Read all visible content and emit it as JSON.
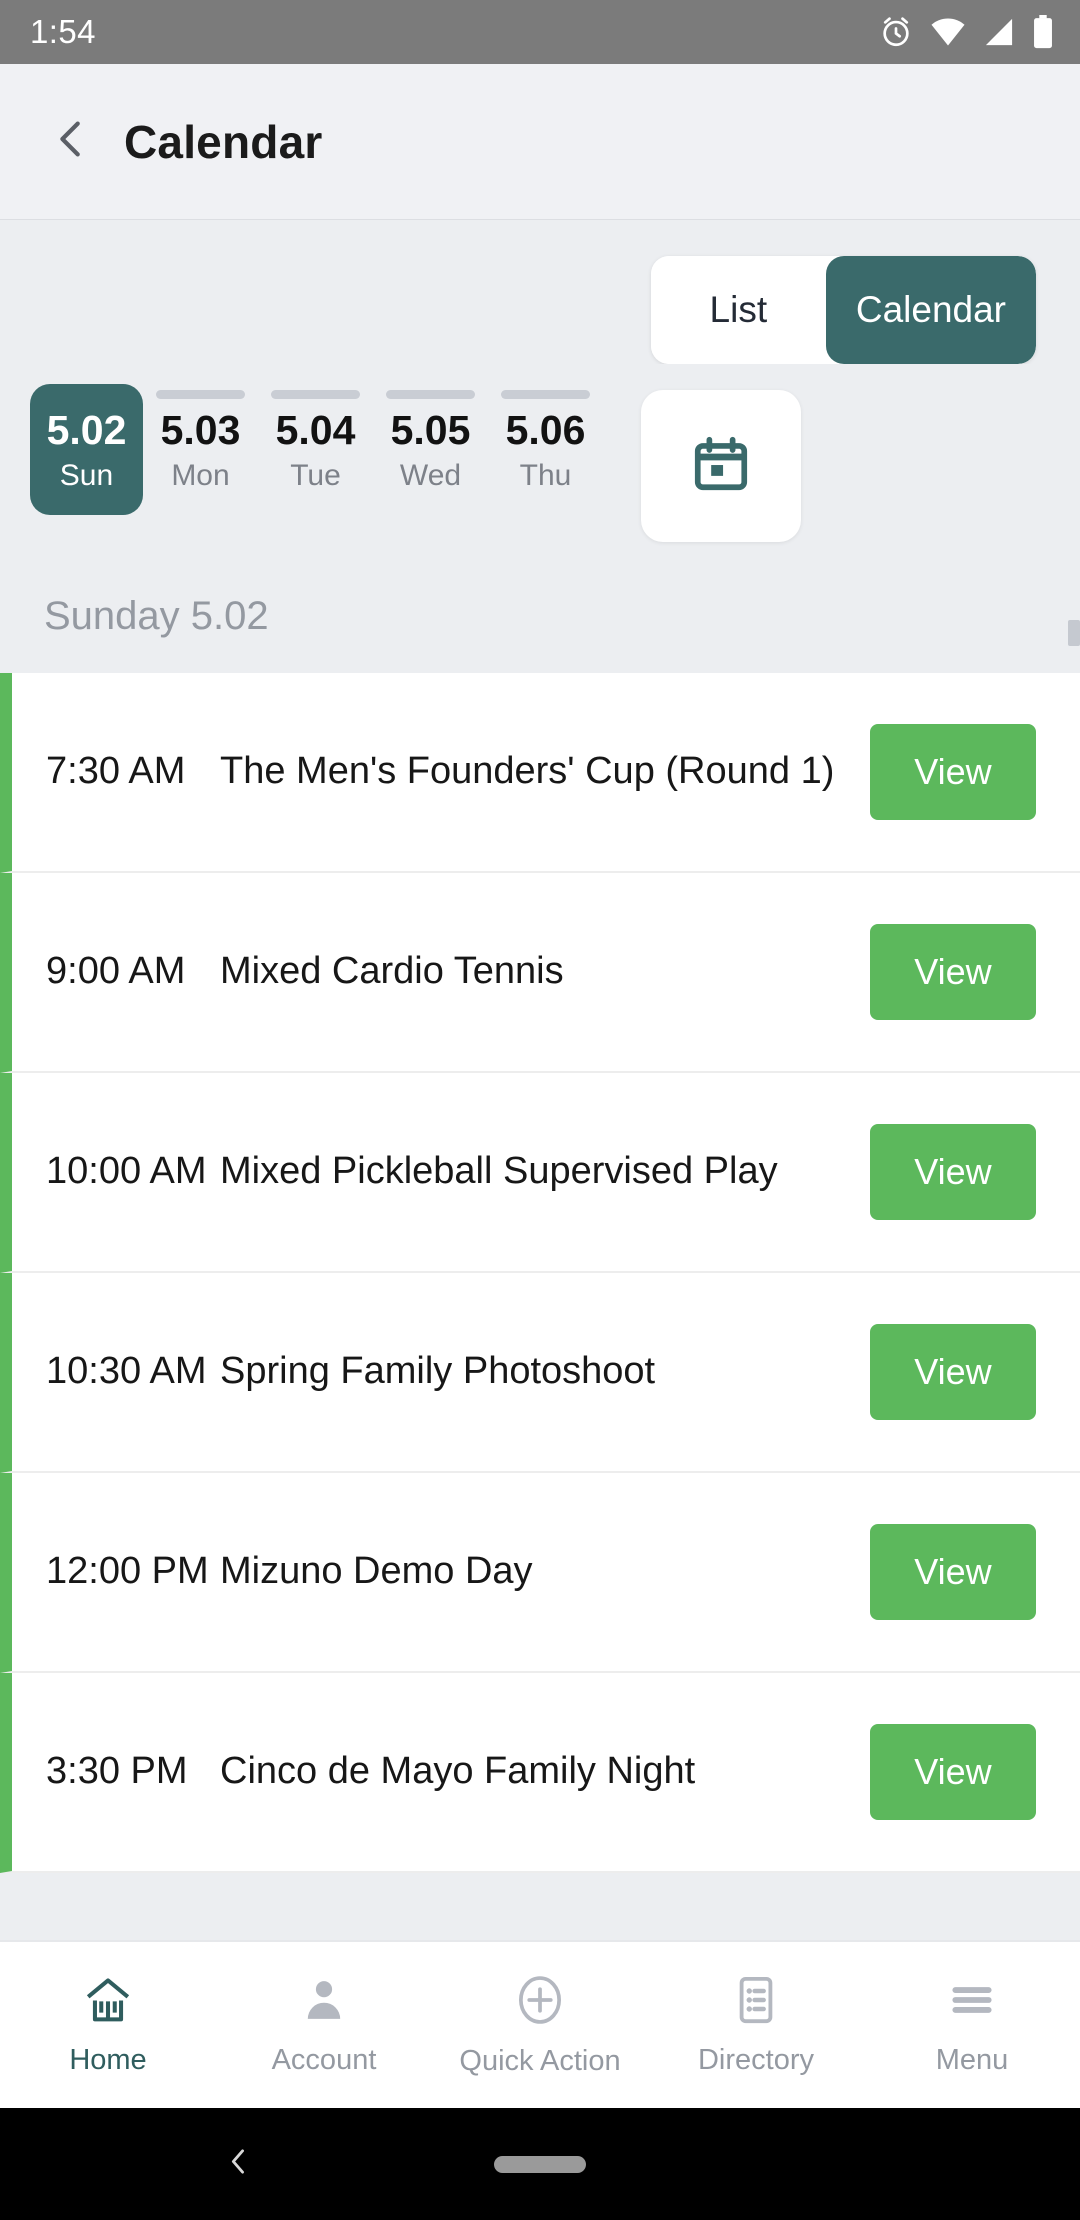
{
  "status_bar": {
    "time": "1:54",
    "icons": [
      "alarm-icon",
      "wifi-icon",
      "cell-signal-icon",
      "battery-icon"
    ]
  },
  "app_bar": {
    "back_icon": "chevron-left-icon",
    "title": "Calendar"
  },
  "view_toggle": {
    "options": [
      {
        "label": "List",
        "active": false
      },
      {
        "label": "Calendar",
        "active": true
      }
    ]
  },
  "date_strip": {
    "dates": [
      {
        "date": "5.02",
        "day": "Sun",
        "selected": true
      },
      {
        "date": "5.03",
        "day": "Mon",
        "selected": false
      },
      {
        "date": "5.04",
        "day": "Tue",
        "selected": false
      },
      {
        "date": "5.05",
        "day": "Wed",
        "selected": false
      },
      {
        "date": "5.06",
        "day": "Thu",
        "selected": false
      }
    ],
    "picker_icon": "calendar-icon"
  },
  "day_header": "Sunday 5.02",
  "events": [
    {
      "time": "7:30 AM",
      "title": "The Men's Founders' Cup (Round 1)",
      "action": "View"
    },
    {
      "time": "9:00 AM",
      "title": "Mixed Cardio Tennis",
      "action": "View"
    },
    {
      "time": "10:00 AM",
      "title": "Mixed Pickleball Supervised Play",
      "action": "View"
    },
    {
      "time": "10:30 AM",
      "title": "Spring Family Photoshoot",
      "action": "View"
    },
    {
      "time": "12:00 PM",
      "title": "Mizuno Demo Day",
      "action": "View"
    },
    {
      "time": "3:30 PM",
      "title": "Cinco de Mayo Family Night",
      "action": "View"
    }
  ],
  "bottom_nav": [
    {
      "label": "Home",
      "icon": "home-icon",
      "active": true
    },
    {
      "label": "Account",
      "icon": "person-icon",
      "active": false
    },
    {
      "label": "Quick Action",
      "icon": "plus-circle-icon",
      "active": false
    },
    {
      "label": "Directory",
      "icon": "list-doc-icon",
      "active": false
    },
    {
      "label": "Menu",
      "icon": "hamburger-icon",
      "active": false
    }
  ],
  "colors": {
    "accent_teal": "#3a6a6b",
    "action_green": "#5cb85c",
    "page_background": "#eceef1",
    "status_bar": "#7b7b7b"
  }
}
